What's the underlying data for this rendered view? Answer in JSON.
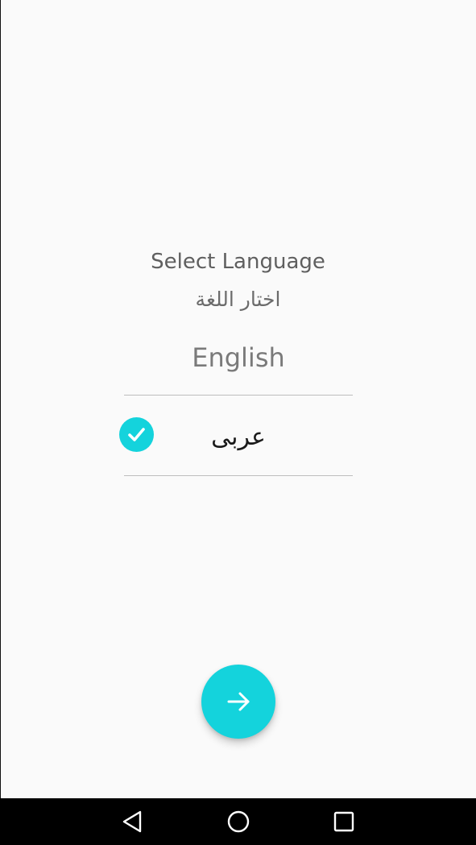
{
  "screen": {
    "title_en": "Select Language",
    "title_ar": "اختار اللغة"
  },
  "languages": [
    {
      "label": "English",
      "selected": false
    },
    {
      "label": "عربى",
      "selected": true
    }
  ],
  "fab": {
    "icon": "arrow-right-icon"
  },
  "navbar": {
    "back_icon": "back-triangle-icon",
    "home_icon": "home-circle-icon",
    "recents_icon": "recents-square-icon"
  },
  "colors": {
    "accent": "#14d3dc",
    "background": "#fafafa",
    "navbar": "#000000"
  }
}
